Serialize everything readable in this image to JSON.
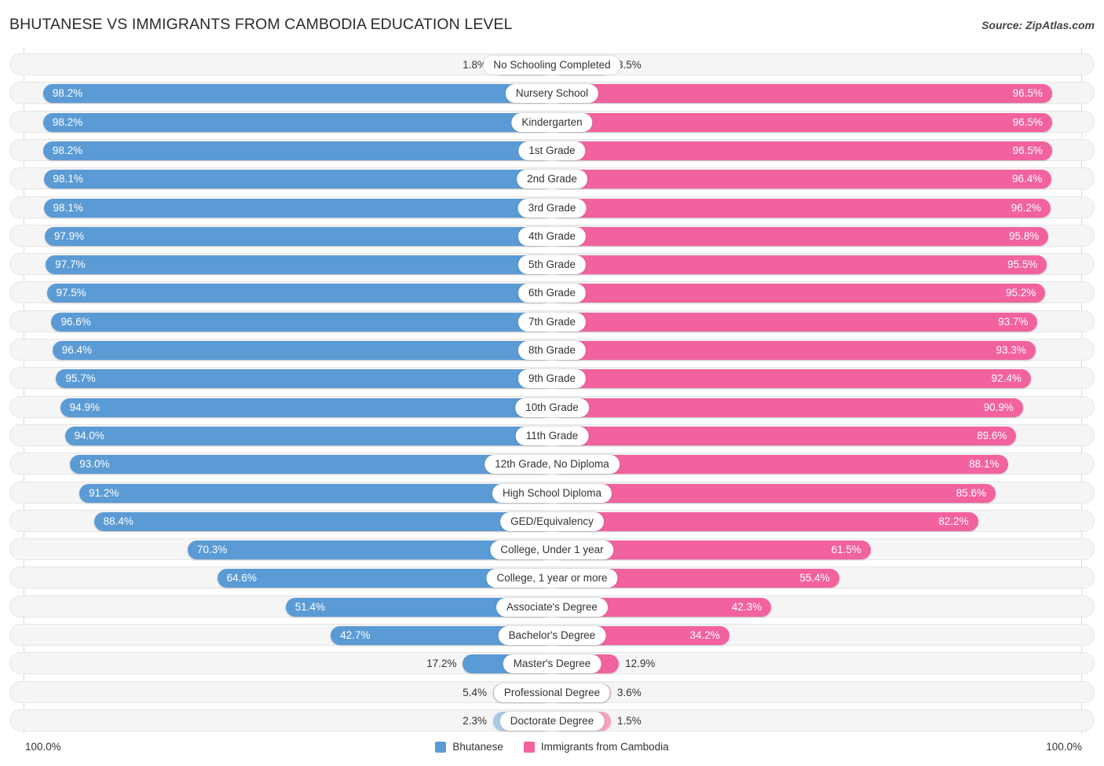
{
  "header": {
    "title": "BHUTANESE VS IMMIGRANTS FROM CAMBODIA EDUCATION LEVEL",
    "source": "Source: ZipAtlas.com"
  },
  "footer": {
    "axis_min": "100.0%",
    "axis_max": "100.0%",
    "legend": [
      {
        "label": "Bhutanese",
        "color": "#5b9bd5"
      },
      {
        "label": "Immigrants from Cambodia",
        "color": "#f2629f"
      }
    ]
  },
  "colors": {
    "left_bar": "#5b9bd5",
    "right_bar": "#f2629f",
    "left_bar_pale": "#a8c8e8",
    "right_bar_pale": "#f5a0bd",
    "row_track": "#f5f5f5",
    "gridline": "#d9d9d9"
  },
  "chart_data": {
    "type": "bar",
    "title": "BHUTANESE VS IMMIGRANTS FROM CAMBODIA EDUCATION LEVEL",
    "subtitle": "",
    "orientation": "horizontal-diverging",
    "xlabel": "",
    "ylabel": "",
    "xlim": [
      0,
      100
    ],
    "grid": true,
    "legend_position": "bottom-center",
    "axis_tick_labels": [
      "100.0%",
      "100.0%"
    ],
    "categories": [
      "No Schooling Completed",
      "Nursery School",
      "Kindergarten",
      "1st Grade",
      "2nd Grade",
      "3rd Grade",
      "4th Grade",
      "5th Grade",
      "6th Grade",
      "7th Grade",
      "8th Grade",
      "9th Grade",
      "10th Grade",
      "11th Grade",
      "12th Grade, No Diploma",
      "High School Diploma",
      "GED/Equivalency",
      "College, Under 1 year",
      "College, 1 year or more",
      "Associate's Degree",
      "Bachelor's Degree",
      "Master's Degree",
      "Professional Degree",
      "Doctorate Degree"
    ],
    "series": [
      {
        "name": "Bhutanese",
        "color": "#5b9bd5",
        "values": [
          1.8,
          98.2,
          98.2,
          98.2,
          98.1,
          98.1,
          97.9,
          97.7,
          97.5,
          96.6,
          96.4,
          95.7,
          94.9,
          94.0,
          93.0,
          91.2,
          88.4,
          70.3,
          64.6,
          51.4,
          42.7,
          17.2,
          5.4,
          2.3
        ],
        "labels": [
          "1.8%",
          "98.2%",
          "98.2%",
          "98.2%",
          "98.1%",
          "98.1%",
          "97.9%",
          "97.7%",
          "97.5%",
          "96.6%",
          "96.4%",
          "95.7%",
          "94.9%",
          "94.0%",
          "93.0%",
          "91.2%",
          "88.4%",
          "70.3%",
          "64.6%",
          "51.4%",
          "42.7%",
          "17.2%",
          "5.4%",
          "2.3%"
        ]
      },
      {
        "name": "Immigrants from Cambodia",
        "color": "#f2629f",
        "values": [
          3.5,
          96.5,
          96.5,
          96.5,
          96.4,
          96.2,
          95.8,
          95.5,
          95.2,
          93.7,
          93.3,
          92.4,
          90.9,
          89.6,
          88.1,
          85.6,
          82.2,
          61.5,
          55.4,
          42.3,
          34.2,
          12.9,
          3.6,
          1.5
        ],
        "labels": [
          "3.5%",
          "96.5%",
          "96.5%",
          "96.5%",
          "96.4%",
          "96.2%",
          "95.8%",
          "95.5%",
          "95.2%",
          "93.7%",
          "93.3%",
          "92.4%",
          "90.9%",
          "89.6%",
          "88.1%",
          "85.6%",
          "82.2%",
          "61.5%",
          "55.4%",
          "42.3%",
          "34.2%",
          "12.9%",
          "3.6%",
          "1.5%"
        ]
      }
    ]
  }
}
